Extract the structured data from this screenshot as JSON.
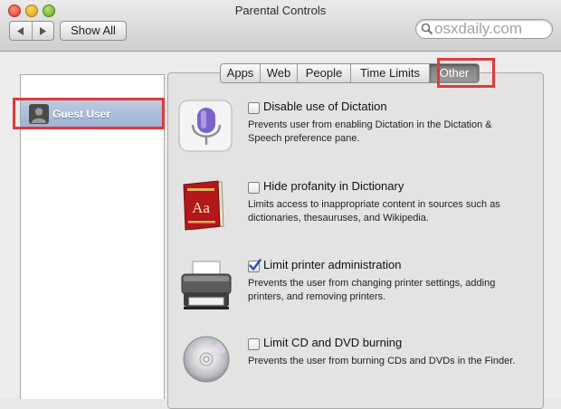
{
  "window": {
    "title": "Parental Controls"
  },
  "toolbar": {
    "show_all_label": "Show All",
    "search_placeholder": "osxdaily.com"
  },
  "users": [
    {
      "name": "Guest User",
      "selected": true
    }
  ],
  "tabs": [
    {
      "label": "Apps",
      "active": false
    },
    {
      "label": "Web",
      "active": false
    },
    {
      "label": "People",
      "active": false
    },
    {
      "label": "Time Limits",
      "active": false
    },
    {
      "label": "Other",
      "active": true
    }
  ],
  "options": [
    {
      "icon": "microphone-icon",
      "label": "Disable use of Dictation",
      "checked": false,
      "description": "Prevents user from enabling Dictation in the Dictation & Speech preference pane."
    },
    {
      "icon": "dictionary-icon",
      "label": "Hide profanity in Dictionary",
      "checked": false,
      "description": "Limits access to inappropriate content in sources such as dictionaries, thesauruses, and Wikipedia."
    },
    {
      "icon": "printer-icon",
      "label": "Limit printer administration",
      "checked": true,
      "description": "Prevents the user from changing printer settings, adding printers, and removing printers."
    },
    {
      "icon": "cd-icon",
      "label": "Limit CD and DVD burning",
      "checked": false,
      "description": "Prevents the user from burning CDs and DVDs in the Finder."
    }
  ],
  "dictionary_icon_text": "Aa",
  "colors": {
    "highlight": "#e0393b",
    "selection": "#a9bad8",
    "checkmark": "#1f4fae"
  }
}
